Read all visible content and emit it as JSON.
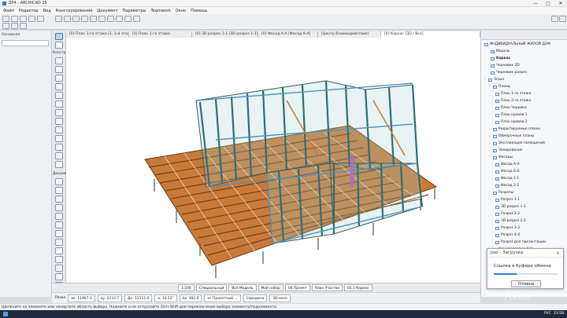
{
  "window": {
    "title": "ZP4 - ARCHICAD 25",
    "buttons": [
      "—",
      "▢",
      "✕"
    ]
  },
  "menu": [
    "Файл",
    "Редактор",
    "Вид",
    "Конструирование",
    "Документ",
    "Параметры",
    "Teamwork",
    "Окно",
    "Помощь"
  ],
  "tabs": [
    {
      "label": "[0] План 1-го этажа [1. 1-й этаж]"
    },
    {
      "label": "[0] План 1-го этажа"
    },
    {
      "label": "[0] 3D разрез 1-1 [3D разрез 1-1]"
    },
    {
      "label": "[0] Фасад А-А [Фасад А-А]"
    },
    {
      "label": "[Центр Взаимодействия]"
    },
    {
      "label": "[0] Каркас [3D / Все]",
      "active": true
    }
  ],
  "left_panel": {
    "label": "Основная"
  },
  "toolbox": {
    "section_construct": "Констр",
    "section_doc": "Докуме"
  },
  "navigator": {
    "items": [
      {
        "label": "ИНДИВИДУАЛЬНЫЙ ЖИЛОЙ ДОМ",
        "level": 0
      },
      {
        "label": "Модель",
        "level": 1
      },
      {
        "label": "Каркас",
        "level": 1,
        "bold": true
      },
      {
        "label": "Черновик 2D",
        "level": 1
      },
      {
        "label": "Черновик разрез",
        "level": 1
      },
      {
        "label": "Эскиз",
        "level": 0
      },
      {
        "label": "Планы",
        "level": 1
      },
      {
        "label": "План 1-го этажа",
        "level": 2
      },
      {
        "label": "План 2-го этажа",
        "level": 2
      },
      {
        "label": "План Чердака",
        "level": 2
      },
      {
        "label": "План кровли 1",
        "level": 2
      },
      {
        "label": "План кровли 2",
        "level": 2
      },
      {
        "label": "Редактируемые планы",
        "level": 1
      },
      {
        "label": "Обмерочные планы",
        "level": 1
      },
      {
        "label": "Экспликация помещений",
        "level": 1
      },
      {
        "label": "Зонирование",
        "level": 1
      },
      {
        "label": "Фасады",
        "level": 1
      },
      {
        "label": "Фасад А-А",
        "level": 2
      },
      {
        "label": "Фасад Б-Б",
        "level": 2
      },
      {
        "label": "Фасад 1-1",
        "level": 2
      },
      {
        "label": "Фасад 2-2",
        "level": 2
      },
      {
        "label": "Разрезы",
        "level": 1
      },
      {
        "label": "Разрез 1-1",
        "level": 2
      },
      {
        "label": "3D разрез 1-1",
        "level": 2
      },
      {
        "label": "Разрез 2-2",
        "level": 2
      },
      {
        "label": "3D разрез 2-2",
        "level": 2
      },
      {
        "label": "Разрез 3-3",
        "level": 2
      },
      {
        "label": "Разрез 4-4",
        "level": 2
      },
      {
        "label": "Разрез для презентации",
        "level": 2
      },
      {
        "label": "Осн развертки Х-Н",
        "level": 1
      }
    ]
  },
  "bottom_bar": {
    "zoom": "1:100",
    "items": [
      "Специальный",
      "Вся Модель",
      "Мой набор",
      "04 Проект",
      "План Участка",
      "01.1 Каркас"
    ]
  },
  "info_bar": {
    "scale_label": "Разно",
    "dx": "ах: 11907.3",
    "dy": "ау: 2210.7",
    "len": "Дл: 12111.0",
    "angle": "а: 10.52°",
    "dz": "Δz: 482.0",
    "ref": "от Проектный ...",
    "mode": "3D-окно",
    "center": "Середина"
  },
  "status_text": "Щелкните на элементе или начертите область выбора. Нажмите и не отпускайте Ctrl+Shift для переключения выбора элемента/подэлемента.",
  "popup": {
    "title": "Joxi - Загрузка",
    "message": "Ссылка в буфере обмена",
    "progress": 0.35,
    "button": "Отмена"
  },
  "watermark": "Avito",
  "taskbar": {
    "lang": "РУС",
    "time": "23:58"
  }
}
